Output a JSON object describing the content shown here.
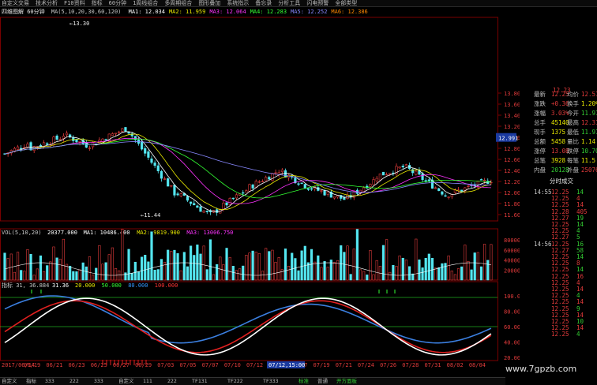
{
  "menu": [
    "自定义交易",
    "技术分析",
    "F10资料",
    "指标",
    "60分钟",
    "1周线组合",
    "多周期组合",
    "图形叠加",
    "系统指示",
    "备忘录",
    "分析工具",
    "闪电预警",
    "全部类型"
  ],
  "kline_header": {
    "title": "四维图解 60分钟",
    "ma_label": "MA(5,10,20,30,60,120)",
    "values": [
      {
        "label": "MA1",
        "value": "12.034",
        "color": "#ffffff"
      },
      {
        "label": "MA2",
        "value": "11.959",
        "color": "#e8e800"
      },
      {
        "label": "MA3",
        "value": "12.064",
        "color": "#ff33ff"
      },
      {
        "label": "MA4",
        "value": "12.283",
        "color": "#33ff33"
      },
      {
        "label": "MA5",
        "value": "12.252",
        "color": "#8888ff"
      },
      {
        "label": "MA6",
        "value": "12.386",
        "color": "#ff8800"
      }
    ]
  },
  "vol_header": {
    "title": "VOL(5,10,20)",
    "values": [
      {
        "label": "",
        "value": "20377.000",
        "color": "#ffffff"
      },
      {
        "label": "MA1",
        "value": "10486.400",
        "color": "#ffffff"
      },
      {
        "label": "MA2",
        "value": "9819.900",
        "color": "#e8e800"
      },
      {
        "label": "MA3",
        "value": "13006.750",
        "color": "#ff33ff"
      }
    ]
  },
  "kdj_header": {
    "title": "指标 31, 36.884",
    "values": [
      {
        "label": "",
        "value": "31.36",
        "color": "#ffffff"
      },
      {
        "label": "",
        "value": "20.000",
        "color": "#e8e800"
      },
      {
        "label": "",
        "value": "50.000",
        "color": "#33ff33"
      },
      {
        "label": "",
        "value": "80.000",
        "color": "#3399ff"
      },
      {
        "label": "",
        "value": "100.000",
        "color": "#ff3333"
      }
    ]
  },
  "chart_annotations": {
    "high": "13.30",
    "low": "11.44",
    "cursor_price": "12.991"
  },
  "price_axis": [
    "13.80",
    "13.60",
    "13.40",
    "13.20",
    "13.00",
    "12.80",
    "12.60",
    "12.40",
    "12.20",
    "12.00",
    "11.80",
    "11.60"
  ],
  "vol_axis": [
    "80000",
    "60000",
    "40000",
    "20000"
  ],
  "kdj_axis": [
    "100.00",
    "80.00",
    "60.00",
    "40.00",
    "20.00"
  ],
  "date_axis": [
    "2017/06/14",
    "06/19",
    "06/21",
    "06/23",
    "06/25",
    "06/27",
    "06/29",
    "07/03",
    "07/05",
    "07/07",
    "07/10",
    "07/12",
    "07/14",
    "07/17",
    "07/19",
    "07/21",
    "07/24",
    "07/26",
    "07/28",
    "07/31",
    "08/02",
    "08/04"
  ],
  "cursor_date": "07/12,15:00",
  "quote": {
    "top_price": "12.23",
    "rows": [
      {
        "l": "最新",
        "v": "12.25",
        "l2": "均价",
        "v2": "12.51",
        "c": "#e23b3b",
        "c2": "#e23b3b"
      },
      {
        "l": "涨跌",
        "v": "+0.36",
        "l2": "换手",
        "v2": "1.20%",
        "c": "#e23b3b",
        "c2": "#e8e800"
      },
      {
        "l": "涨幅",
        "v": "3.03%",
        "l2": "今开",
        "v2": "11.91",
        "c": "#e23b3b",
        "c2": "#33cc33"
      },
      {
        "l": "总手",
        "v": "45140",
        "l2": "最高",
        "v2": "12.31",
        "c": "#e8e800",
        "c2": "#e23b3b"
      },
      {
        "l": "现手",
        "v": "1375",
        "l2": "最低",
        "v2": "11.91",
        "c": "#e8e800",
        "c2": "#33cc33"
      },
      {
        "l": "总额",
        "v": "5458",
        "l2": "量比",
        "v2": "1.14",
        "c": "#e8e800",
        "c2": "#e8e800"
      },
      {
        "l": "涨停",
        "v": "13.08",
        "l2": "跌停",
        "v2": "10.70",
        "c": "#e23b3b",
        "c2": "#33cc33"
      },
      {
        "l": "总笔",
        "v": "3928",
        "l2": "每笔",
        "v2": "11.5",
        "c": "#e8e800",
        "c2": "#e8e800"
      },
      {
        "l": "内盘",
        "v": "20128",
        "l2": "外盘",
        "v2": "25076",
        "c": "#33cc33",
        "c2": "#e23b3b"
      }
    ],
    "tab": "分时成交",
    "ticks": [
      {
        "t": "14:55",
        "p": "12.25",
        "v": "14",
        "c": "#33cc33"
      },
      {
        "t": "",
        "p": "12.25",
        "v": "4",
        "c": "#e23b3b"
      },
      {
        "t": "",
        "p": "12.25",
        "v": "14",
        "c": "#e23b3b"
      },
      {
        "t": "",
        "p": "12.28",
        "v": "405",
        "c": "#e23b3b"
      },
      {
        "t": "",
        "p": "12.27",
        "v": "19",
        "c": "#33cc33"
      },
      {
        "t": "",
        "p": "12.25",
        "v": "14",
        "c": "#33cc33"
      },
      {
        "t": "",
        "p": "12.25",
        "v": "4",
        "c": "#33cc33"
      },
      {
        "t": "",
        "p": "12.27",
        "v": "5",
        "c": "#33cc33"
      },
      {
        "t": "14:56",
        "p": "12.25",
        "v": "16",
        "c": "#33cc33"
      },
      {
        "t": "",
        "p": "12.27",
        "v": "58",
        "c": "#33cc33"
      },
      {
        "t": "",
        "p": "12.25",
        "v": "14",
        "c": "#33cc33"
      },
      {
        "t": "",
        "p": "12.25",
        "v": "8",
        "c": "#e23b3b"
      },
      {
        "t": "",
        "p": "12.25",
        "v": "14",
        "c": "#33cc33"
      },
      {
        "t": "",
        "p": "12.25",
        "v": "16",
        "c": "#e23b3b"
      },
      {
        "t": "",
        "p": "12.25",
        "v": "4",
        "c": "#e23b3b"
      },
      {
        "t": "",
        "p": "12.25",
        "v": "14",
        "c": "#e23b3b"
      },
      {
        "t": "",
        "p": "12.25",
        "v": "4",
        "c": "#33cc33"
      },
      {
        "t": "",
        "p": "12.25",
        "v": "14",
        "c": "#e23b3b"
      },
      {
        "t": "",
        "p": "12.25",
        "v": "9",
        "c": "#33cc33"
      },
      {
        "t": "",
        "p": "12.25",
        "v": "14",
        "c": "#e23b3b"
      },
      {
        "t": "",
        "p": "12.25",
        "v": "10",
        "c": "#33cc33"
      },
      {
        "t": "",
        "p": "12.25",
        "v": "14",
        "c": "#e23b3b"
      },
      {
        "t": "",
        "p": "12.25",
        "v": "4",
        "c": "#33cc33"
      },
      {
        "t": "",
        "p": "12.25",
        "v": "4",
        "c": "#33cc33"
      },
      {
        "t": "",
        "p": "12.25",
        "v": "14",
        "c": "#e23b3b"
      }
    ]
  },
  "bottom_tabs": [
    "自定义",
    "指标",
    "333",
    "222",
    "333",
    "自定义",
    "111",
    "222",
    "TF131",
    "TF222",
    "TF333",
    "标准",
    "普通",
    "开方面板"
  ],
  "watermark": "www.7gpzb.com",
  "colors": {
    "up": "#e23b3b",
    "down": "#54e6f0",
    "grid": "#7a0000"
  }
}
